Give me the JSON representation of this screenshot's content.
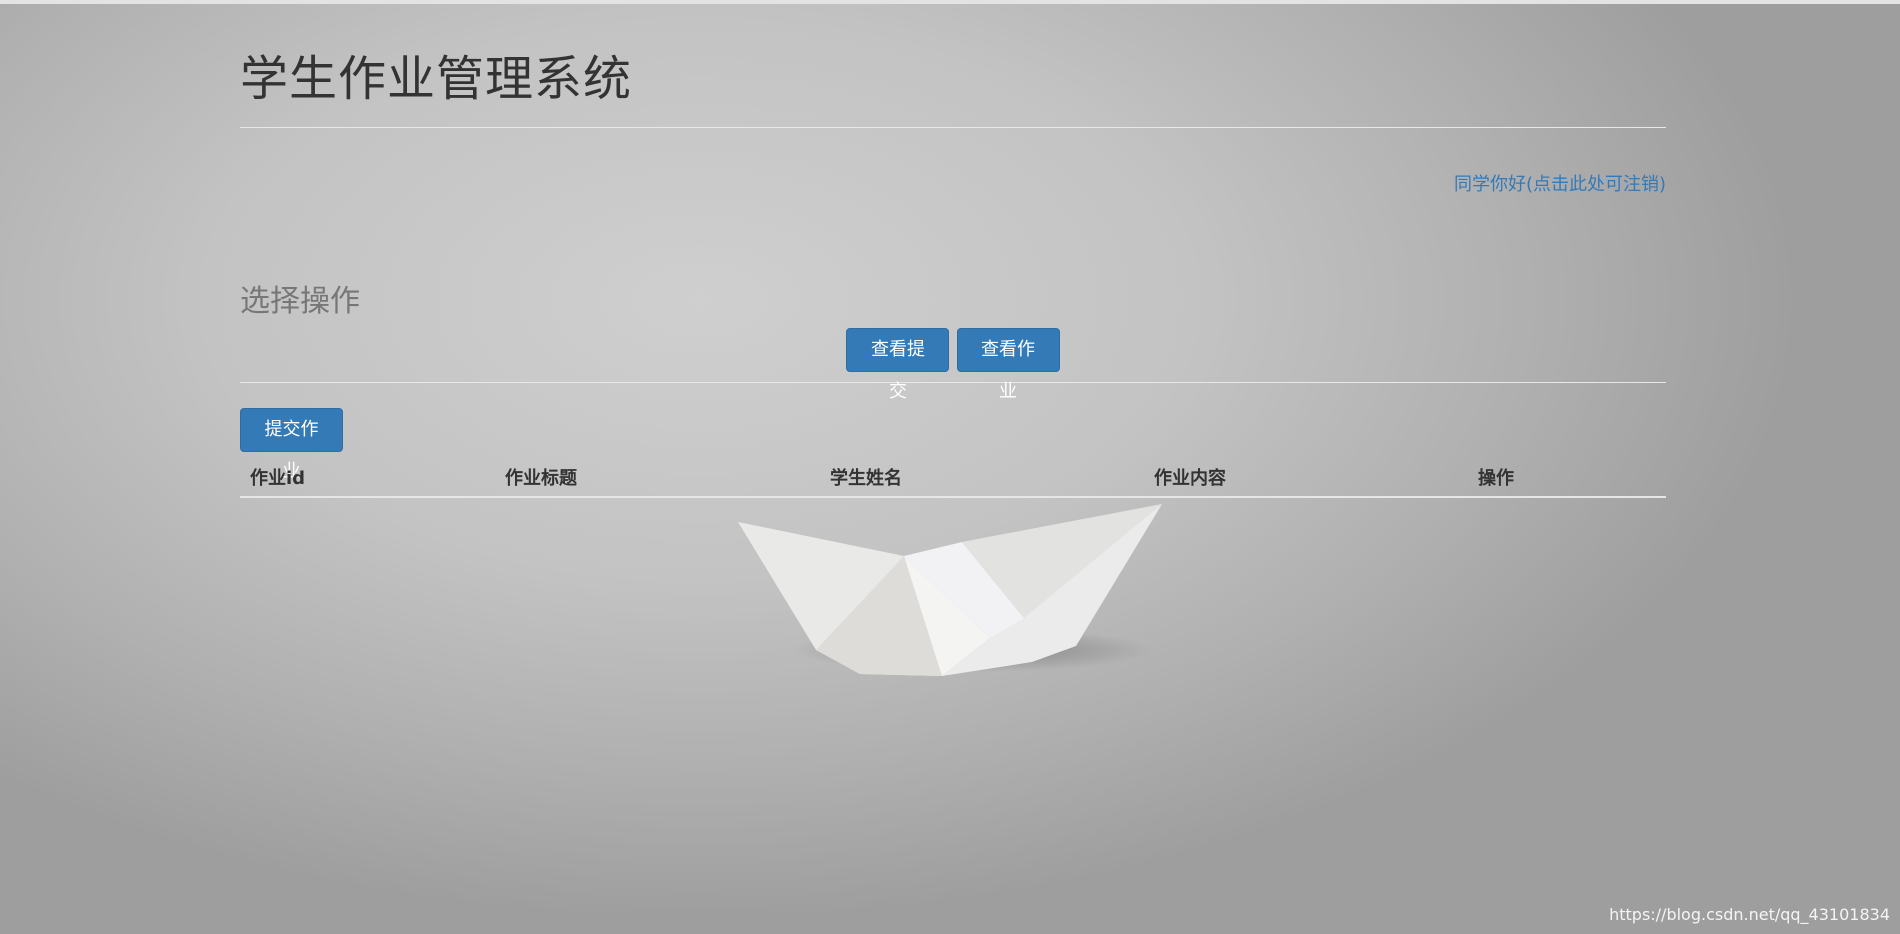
{
  "header": {
    "title": "学生作业管理系统"
  },
  "user": {
    "greeting": "同学你好(点击此处可注销)"
  },
  "operations": {
    "title": "选择操作",
    "view_submissions": "查看提交",
    "view_homework": "查看作业"
  },
  "actions": {
    "submit_homework": "提交作业"
  },
  "table": {
    "columns": [
      "作业id",
      "作业标题",
      "学生姓名",
      "作业内容",
      "操作"
    ],
    "rows": []
  },
  "watermark": "https://blog.csdn.net/qq_43101834",
  "colors": {
    "primary": "#337ab7",
    "link": "#337ab7",
    "background": "#c4c4c4"
  }
}
